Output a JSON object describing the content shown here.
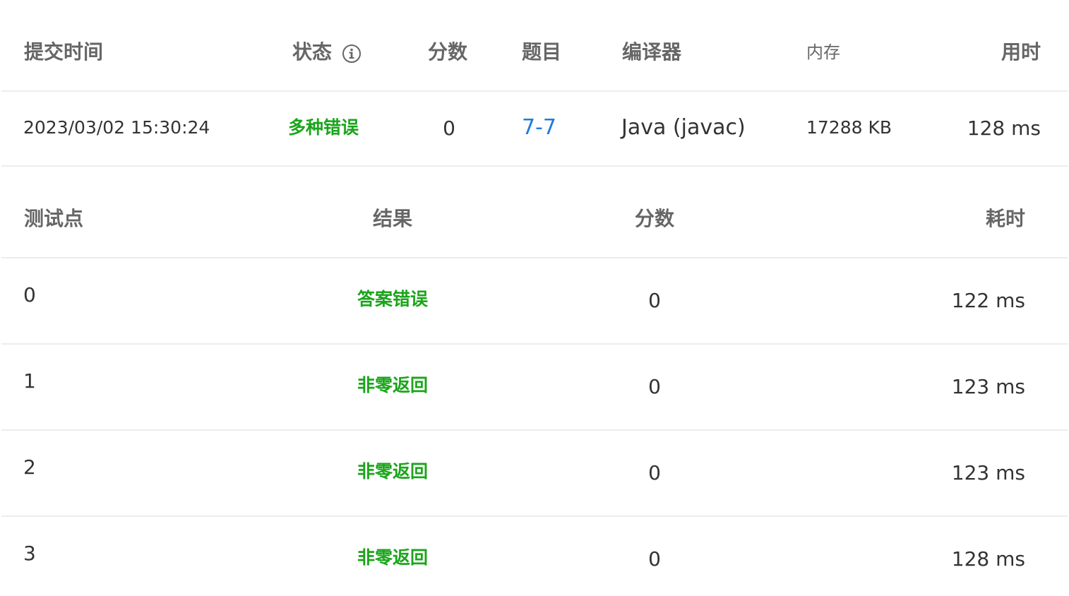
{
  "submission_table": {
    "headers": {
      "time": "提交时间",
      "status": "状态",
      "score": "分数",
      "problem": "题目",
      "compiler": "编译器",
      "memory": "内存",
      "duration": "用时"
    },
    "row": {
      "time": "2023/03/02 15:30:24",
      "status": "多种错误",
      "score": "0",
      "problem": "7-7",
      "compiler": "Java (javac)",
      "memory": "17288 KB",
      "duration": "128 ms"
    }
  },
  "testcase_table": {
    "headers": {
      "point": "测试点",
      "result": "结果",
      "score": "分数",
      "time": "耗时"
    },
    "rows": [
      {
        "point": "0",
        "result": "答案错误",
        "score": "0",
        "time": "122 ms"
      },
      {
        "point": "1",
        "result": "非零返回",
        "score": "0",
        "time": "123 ms"
      },
      {
        "point": "2",
        "result": "非零返回",
        "score": "0",
        "time": "123 ms"
      },
      {
        "point": "3",
        "result": "非零返回",
        "score": "0",
        "time": "128 ms"
      }
    ]
  },
  "colors": {
    "status_green": "#1aa51a",
    "link_blue": "#1f7ae0",
    "divider": "#ececec"
  },
  "icons": {
    "status_info": "info-circle-icon"
  }
}
